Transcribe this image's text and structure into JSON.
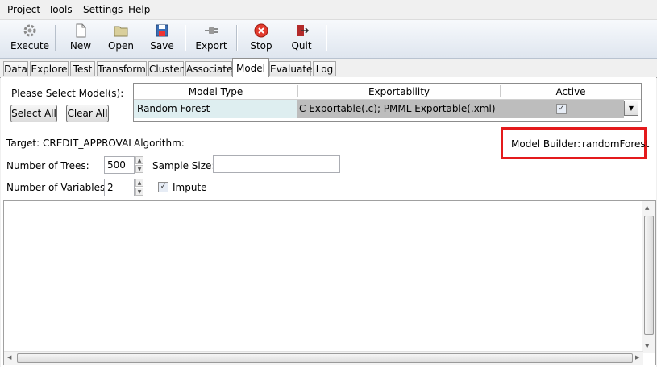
{
  "menu": {
    "items": [
      "Project",
      "Tools",
      "Settings",
      "Help"
    ]
  },
  "toolbar": {
    "execute": "Execute",
    "new": "New",
    "open": "Open",
    "save": "Save",
    "export": "Export",
    "stop": "Stop",
    "quit": "Quit"
  },
  "tabs": [
    "Data",
    "Explore",
    "Test",
    "Transform",
    "Cluster",
    "Associate",
    "Model",
    "Evaluate",
    "Log"
  ],
  "active_tab": "Model",
  "model_select": {
    "prompt": "Please Select Model(s):",
    "select_all": "Select All",
    "clear_all": "Clear All",
    "headers": {
      "model_type": "Model Type",
      "exportability": "Exportability",
      "active": "Active"
    },
    "row": {
      "model_type": "Random Forest",
      "exportability": "C Exportable(.c); PMML Exportable(.xml)",
      "active": true
    }
  },
  "info": {
    "target": "Target: CREDIT_APPROVAL",
    "algorithm": "Algorithm:",
    "builder_label": "Model Builder:",
    "builder_value": "randomForest"
  },
  "params": {
    "num_trees_label": "Number of Trees:",
    "num_trees": "500",
    "sample_size_label": "Sample Size:",
    "sample_size": "",
    "num_vars_label": "Number of Variables:",
    "num_vars": "2",
    "impute_label": "Impute",
    "impute_checked": true
  },
  "colors": {
    "highlight_box": "#e41a1c",
    "model_cell": "#deeef0",
    "export_cell": "#bdbdbd"
  }
}
